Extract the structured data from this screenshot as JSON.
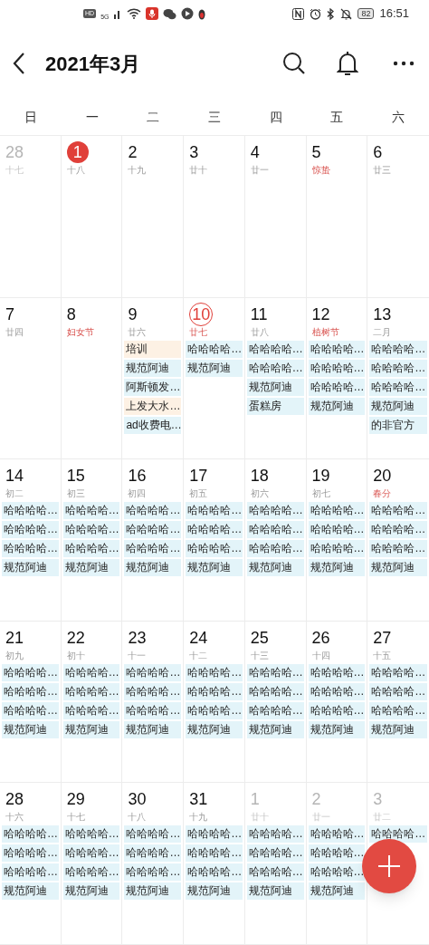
{
  "status_bar": {
    "network_labels": [
      "HD",
      "5G"
    ],
    "battery": "82",
    "time": "16:51"
  },
  "header": {
    "title": "2021年3月"
  },
  "weekdays": [
    "日",
    "一",
    "二",
    "三",
    "四",
    "五",
    "六"
  ],
  "weeks": [
    [
      {
        "day": "28",
        "lunar": "十七",
        "festival": false,
        "other_month": true,
        "selected": false,
        "today": false
      },
      {
        "day": "1",
        "lunar": "十八",
        "festival": false,
        "other_month": false,
        "selected": true,
        "today": false
      },
      {
        "day": "2",
        "lunar": "十九",
        "festival": false,
        "other_month": false,
        "selected": false,
        "today": false
      },
      {
        "day": "3",
        "lunar": "廿十",
        "festival": false,
        "other_month": false,
        "selected": false,
        "today": false
      },
      {
        "day": "4",
        "lunar": "廿一",
        "festival": false,
        "other_month": false,
        "selected": false,
        "today": false
      },
      {
        "day": "5",
        "lunar": "惊蛰",
        "festival": true,
        "other_month": false,
        "selected": false,
        "today": false
      },
      {
        "day": "6",
        "lunar": "廿三",
        "festival": false,
        "other_month": false,
        "selected": false,
        "today": false
      }
    ],
    [
      {
        "day": "7",
        "lunar": "廿四",
        "festival": false,
        "other_month": false,
        "selected": false,
        "today": false
      },
      {
        "day": "8",
        "lunar": "妇女节",
        "festival": true,
        "other_month": false,
        "selected": false,
        "today": false
      },
      {
        "day": "9",
        "lunar": "廿六",
        "festival": false,
        "other_month": false,
        "selected": false,
        "today": false,
        "events": [
          {
            "text": "培训",
            "color": "#fdf1e4"
          },
          {
            "text": "规范阿迪",
            "color": "#e3f4f9"
          },
          {
            "text": "阿斯顿发…",
            "color": "#e3f4f9"
          },
          {
            "text": "上发大水…",
            "color": "#fdf1e4"
          },
          {
            "text": "ad收费电…",
            "color": "#e3f4f9"
          }
        ]
      },
      {
        "day": "10",
        "lunar": "廿七",
        "festival": false,
        "other_month": false,
        "selected": false,
        "today": true,
        "events": [
          {
            "text": "哈哈哈哈…",
            "color": "#e3f4f9"
          },
          {
            "text": "规范阿迪",
            "color": "#e3f4f9"
          }
        ]
      },
      {
        "day": "11",
        "lunar": "廿八",
        "festival": false,
        "other_month": false,
        "selected": false,
        "today": false,
        "events": [
          {
            "text": "哈哈哈哈…",
            "color": "#e3f4f9"
          },
          {
            "text": "哈哈哈哈…",
            "color": "#e3f4f9"
          },
          {
            "text": "规范阿迪",
            "color": "#e3f4f9"
          },
          {
            "text": "蛋糕房",
            "color": "#e3f4f9"
          }
        ]
      },
      {
        "day": "12",
        "lunar": "植树节",
        "festival": true,
        "other_month": false,
        "selected": false,
        "today": false,
        "events": [
          {
            "text": "哈哈哈哈…",
            "color": "#e3f4f9"
          },
          {
            "text": "哈哈哈哈…",
            "color": "#e3f4f9"
          },
          {
            "text": "哈哈哈哈…",
            "color": "#e3f4f9"
          },
          {
            "text": "规范阿迪",
            "color": "#e3f4f9"
          }
        ]
      },
      {
        "day": "13",
        "lunar": "二月",
        "festival": false,
        "other_month": false,
        "selected": false,
        "today": false,
        "events": [
          {
            "text": "哈哈哈哈…",
            "color": "#e3f4f9"
          },
          {
            "text": "哈哈哈哈…",
            "color": "#e3f4f9"
          },
          {
            "text": "哈哈哈哈…",
            "color": "#e3f4f9"
          },
          {
            "text": "规范阿迪",
            "color": "#e3f4f9"
          },
          {
            "text": "的非官方",
            "color": "#e3f4f9"
          }
        ]
      }
    ],
    [
      {
        "day": "14",
        "lunar": "初二",
        "festival": false,
        "other_month": false,
        "selected": false,
        "today": false,
        "events": [
          {
            "text": "哈哈哈哈…",
            "color": "#e3f4f9"
          },
          {
            "text": "哈哈哈哈…",
            "color": "#e3f4f9"
          },
          {
            "text": "哈哈哈哈…",
            "color": "#e3f4f9"
          },
          {
            "text": "规范阿迪",
            "color": "#e3f4f9"
          }
        ]
      },
      {
        "day": "15",
        "lunar": "初三",
        "festival": false,
        "other_month": false,
        "selected": false,
        "today": false,
        "events": [
          {
            "text": "哈哈哈哈…",
            "color": "#e3f4f9"
          },
          {
            "text": "哈哈哈哈…",
            "color": "#e3f4f9"
          },
          {
            "text": "哈哈哈哈…",
            "color": "#e3f4f9"
          },
          {
            "text": "规范阿迪",
            "color": "#e3f4f9"
          }
        ]
      },
      {
        "day": "16",
        "lunar": "初四",
        "festival": false,
        "other_month": false,
        "selected": false,
        "today": false,
        "events": [
          {
            "text": "哈哈哈哈…",
            "color": "#e3f4f9"
          },
          {
            "text": "哈哈哈哈…",
            "color": "#e3f4f9"
          },
          {
            "text": "哈哈哈哈…",
            "color": "#e3f4f9"
          },
          {
            "text": "规范阿迪",
            "color": "#e3f4f9"
          }
        ]
      },
      {
        "day": "17",
        "lunar": "初五",
        "festival": false,
        "other_month": false,
        "selected": false,
        "today": false,
        "events": [
          {
            "text": "哈哈哈哈…",
            "color": "#e3f4f9"
          },
          {
            "text": "哈哈哈哈…",
            "color": "#e3f4f9"
          },
          {
            "text": "哈哈哈哈…",
            "color": "#e3f4f9"
          },
          {
            "text": "规范阿迪",
            "color": "#e3f4f9"
          }
        ]
      },
      {
        "day": "18",
        "lunar": "初六",
        "festival": false,
        "other_month": false,
        "selected": false,
        "today": false,
        "events": [
          {
            "text": "哈哈哈哈…",
            "color": "#e3f4f9"
          },
          {
            "text": "哈哈哈哈…",
            "color": "#e3f4f9"
          },
          {
            "text": "哈哈哈哈…",
            "color": "#e3f4f9"
          },
          {
            "text": "规范阿迪",
            "color": "#e3f4f9"
          }
        ]
      },
      {
        "day": "19",
        "lunar": "初七",
        "festival": false,
        "other_month": false,
        "selected": false,
        "today": false,
        "events": [
          {
            "text": "哈哈哈哈…",
            "color": "#e3f4f9"
          },
          {
            "text": "哈哈哈哈…",
            "color": "#e3f4f9"
          },
          {
            "text": "哈哈哈哈…",
            "color": "#e3f4f9"
          },
          {
            "text": "规范阿迪",
            "color": "#e3f4f9"
          }
        ]
      },
      {
        "day": "20",
        "lunar": "春分",
        "festival": true,
        "other_month": false,
        "selected": false,
        "today": false,
        "events": [
          {
            "text": "哈哈哈哈…",
            "color": "#e3f4f9"
          },
          {
            "text": "哈哈哈哈…",
            "color": "#e3f4f9"
          },
          {
            "text": "哈哈哈哈…",
            "color": "#e3f4f9"
          },
          {
            "text": "规范阿迪",
            "color": "#e3f4f9"
          }
        ]
      }
    ],
    [
      {
        "day": "21",
        "lunar": "初九",
        "festival": false,
        "other_month": false,
        "selected": false,
        "today": false,
        "events": [
          {
            "text": "哈哈哈哈…",
            "color": "#e3f4f9"
          },
          {
            "text": "哈哈哈哈…",
            "color": "#e3f4f9"
          },
          {
            "text": "哈哈哈哈…",
            "color": "#e3f4f9"
          },
          {
            "text": "规范阿迪",
            "color": "#e3f4f9"
          }
        ]
      },
      {
        "day": "22",
        "lunar": "初十",
        "festival": false,
        "other_month": false,
        "selected": false,
        "today": false,
        "events": [
          {
            "text": "哈哈哈哈…",
            "color": "#e3f4f9"
          },
          {
            "text": "哈哈哈哈…",
            "color": "#e3f4f9"
          },
          {
            "text": "哈哈哈哈…",
            "color": "#e3f4f9"
          },
          {
            "text": "规范阿迪",
            "color": "#e3f4f9"
          }
        ]
      },
      {
        "day": "23",
        "lunar": "十一",
        "festival": false,
        "other_month": false,
        "selected": false,
        "today": false,
        "events": [
          {
            "text": "哈哈哈哈…",
            "color": "#e3f4f9"
          },
          {
            "text": "哈哈哈哈…",
            "color": "#e3f4f9"
          },
          {
            "text": "哈哈哈哈…",
            "color": "#e3f4f9"
          },
          {
            "text": "规范阿迪",
            "color": "#e3f4f9"
          }
        ]
      },
      {
        "day": "24",
        "lunar": "十二",
        "festival": false,
        "other_month": false,
        "selected": false,
        "today": false,
        "events": [
          {
            "text": "哈哈哈哈…",
            "color": "#e3f4f9"
          },
          {
            "text": "哈哈哈哈…",
            "color": "#e3f4f9"
          },
          {
            "text": "哈哈哈哈…",
            "color": "#e3f4f9"
          },
          {
            "text": "规范阿迪",
            "color": "#e3f4f9"
          }
        ]
      },
      {
        "day": "25",
        "lunar": "十三",
        "festival": false,
        "other_month": false,
        "selected": false,
        "today": false,
        "events": [
          {
            "text": "哈哈哈哈…",
            "color": "#e3f4f9"
          },
          {
            "text": "哈哈哈哈…",
            "color": "#e3f4f9"
          },
          {
            "text": "哈哈哈哈…",
            "color": "#e3f4f9"
          },
          {
            "text": "规范阿迪",
            "color": "#e3f4f9"
          }
        ]
      },
      {
        "day": "26",
        "lunar": "十四",
        "festival": false,
        "other_month": false,
        "selected": false,
        "today": false,
        "events": [
          {
            "text": "哈哈哈哈…",
            "color": "#e3f4f9"
          },
          {
            "text": "哈哈哈哈…",
            "color": "#e3f4f9"
          },
          {
            "text": "哈哈哈哈…",
            "color": "#e3f4f9"
          },
          {
            "text": "规范阿迪",
            "color": "#e3f4f9"
          }
        ]
      },
      {
        "day": "27",
        "lunar": "十五",
        "festival": false,
        "other_month": false,
        "selected": false,
        "today": false,
        "events": [
          {
            "text": "哈哈哈哈…",
            "color": "#e3f4f9"
          },
          {
            "text": "哈哈哈哈…",
            "color": "#e3f4f9"
          },
          {
            "text": "哈哈哈哈…",
            "color": "#e3f4f9"
          },
          {
            "text": "规范阿迪",
            "color": "#e3f4f9"
          }
        ]
      }
    ],
    [
      {
        "day": "28",
        "lunar": "十六",
        "festival": false,
        "other_month": false,
        "selected": false,
        "today": false,
        "events": [
          {
            "text": "哈哈哈哈…",
            "color": "#e3f4f9"
          },
          {
            "text": "哈哈哈哈…",
            "color": "#e3f4f9"
          },
          {
            "text": "哈哈哈哈…",
            "color": "#e3f4f9"
          },
          {
            "text": "规范阿迪",
            "color": "#e3f4f9"
          }
        ]
      },
      {
        "day": "29",
        "lunar": "十七",
        "festival": false,
        "other_month": false,
        "selected": false,
        "today": false,
        "events": [
          {
            "text": "哈哈哈哈…",
            "color": "#e3f4f9"
          },
          {
            "text": "哈哈哈哈…",
            "color": "#e3f4f9"
          },
          {
            "text": "哈哈哈哈…",
            "color": "#e3f4f9"
          },
          {
            "text": "规范阿迪",
            "color": "#e3f4f9"
          }
        ]
      },
      {
        "day": "30",
        "lunar": "十八",
        "festival": false,
        "other_month": false,
        "selected": false,
        "today": false,
        "events": [
          {
            "text": "哈哈哈哈…",
            "color": "#e3f4f9"
          },
          {
            "text": "哈哈哈哈…",
            "color": "#e3f4f9"
          },
          {
            "text": "哈哈哈哈…",
            "color": "#e3f4f9"
          },
          {
            "text": "规范阿迪",
            "color": "#e3f4f9"
          }
        ]
      },
      {
        "day": "31",
        "lunar": "十九",
        "festival": false,
        "other_month": false,
        "selected": false,
        "today": false,
        "events": [
          {
            "text": "哈哈哈哈…",
            "color": "#e3f4f9"
          },
          {
            "text": "哈哈哈哈…",
            "color": "#e3f4f9"
          },
          {
            "text": "哈哈哈哈…",
            "color": "#e3f4f9"
          },
          {
            "text": "规范阿迪",
            "color": "#e3f4f9"
          }
        ]
      },
      {
        "day": "1",
        "lunar": "廿十",
        "festival": false,
        "other_month": true,
        "selected": false,
        "today": false,
        "events": [
          {
            "text": "哈哈哈哈…",
            "color": "#e3f4f9"
          },
          {
            "text": "哈哈哈哈…",
            "color": "#e3f4f9"
          },
          {
            "text": "哈哈哈哈…",
            "color": "#e3f4f9"
          },
          {
            "text": "规范阿迪",
            "color": "#e3f4f9"
          }
        ]
      },
      {
        "day": "2",
        "lunar": "廿一",
        "festival": false,
        "other_month": true,
        "selected": false,
        "today": false,
        "events": [
          {
            "text": "哈哈哈哈…",
            "color": "#e3f4f9"
          },
          {
            "text": "哈哈哈哈…",
            "color": "#e3f4f9"
          },
          {
            "text": "哈哈哈哈…",
            "color": "#e3f4f9"
          },
          {
            "text": "规范阿迪",
            "color": "#e3f4f9"
          }
        ]
      },
      {
        "day": "3",
        "lunar": "廿二",
        "festival": false,
        "other_month": true,
        "selected": false,
        "today": false,
        "events": [
          {
            "text": "哈哈哈哈…",
            "color": "#e3f4f9"
          }
        ]
      }
    ]
  ]
}
